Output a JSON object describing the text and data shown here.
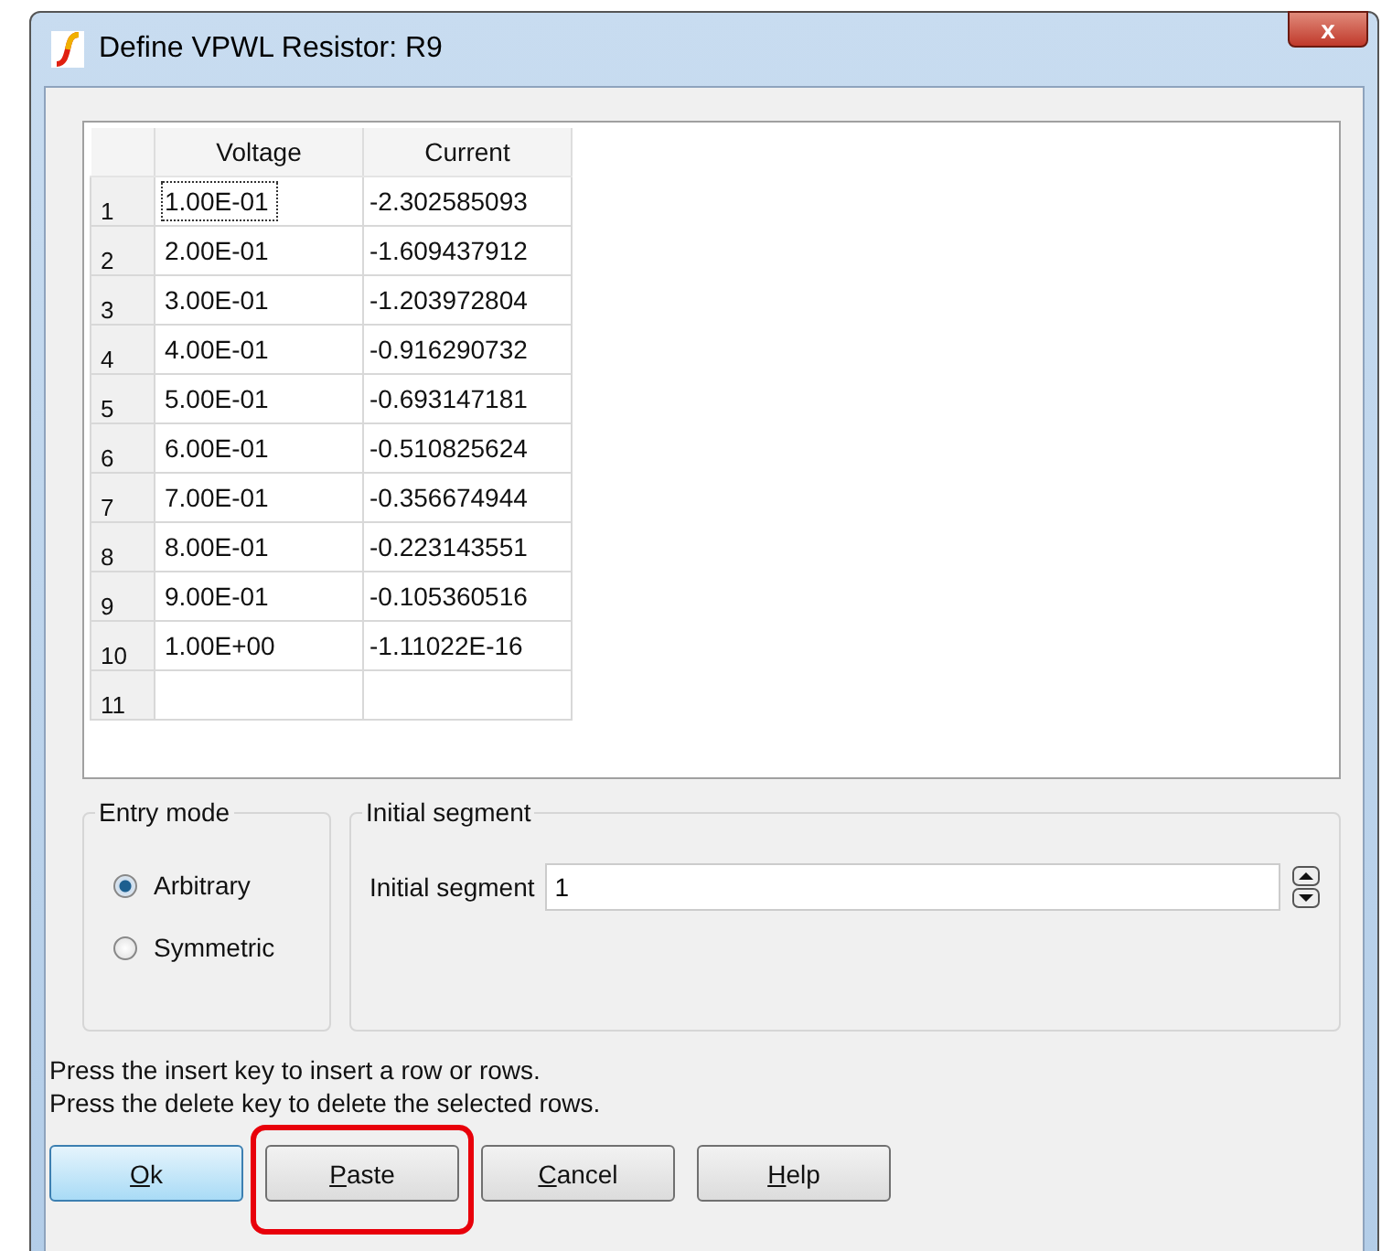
{
  "window": {
    "title": "Define VPWL Resistor: R9",
    "close_label": "x"
  },
  "table": {
    "columns": [
      "Voltage",
      "Current"
    ],
    "rows": [
      {
        "number": "1",
        "voltage": "1.00E-01",
        "current": "-2.302585093",
        "focused": true
      },
      {
        "number": "2",
        "voltage": "2.00E-01",
        "current": "-1.609437912",
        "focused": false
      },
      {
        "number": "3",
        "voltage": "3.00E-01",
        "current": "-1.203972804",
        "focused": false
      },
      {
        "number": "4",
        "voltage": "4.00E-01",
        "current": "-0.916290732",
        "focused": false
      },
      {
        "number": "5",
        "voltage": "5.00E-01",
        "current": "-0.693147181",
        "focused": false
      },
      {
        "number": "6",
        "voltage": "6.00E-01",
        "current": "-0.510825624",
        "focused": false
      },
      {
        "number": "7",
        "voltage": "7.00E-01",
        "current": "-0.356674944",
        "focused": false
      },
      {
        "number": "8",
        "voltage": "8.00E-01",
        "current": "-0.223143551",
        "focused": false
      },
      {
        "number": "9",
        "voltage": "9.00E-01",
        "current": "-0.105360516",
        "focused": false
      },
      {
        "number": "10",
        "voltage": "1.00E+00",
        "current": "-1.11022E-16",
        "focused": false
      },
      {
        "number": "11",
        "voltage": "",
        "current": "",
        "focused": false
      }
    ]
  },
  "entry_mode": {
    "title": "Entry mode",
    "options": [
      {
        "label": "Arbitrary",
        "selected": true
      },
      {
        "label": "Symmetric",
        "selected": false
      }
    ]
  },
  "initial_segment": {
    "title": "Initial segment",
    "label": "Initial segment",
    "value": "1"
  },
  "hints": [
    "Press the insert key to insert a row or rows.",
    "Press the delete key to delete the selected rows."
  ],
  "buttons": [
    {
      "label": "Ok",
      "default": true,
      "highlighted": false
    },
    {
      "label": "Paste",
      "default": false,
      "highlighted": true
    },
    {
      "label": "Cancel",
      "default": false,
      "highlighted": false
    },
    {
      "label": "Help",
      "default": false,
      "highlighted": false
    }
  ]
}
